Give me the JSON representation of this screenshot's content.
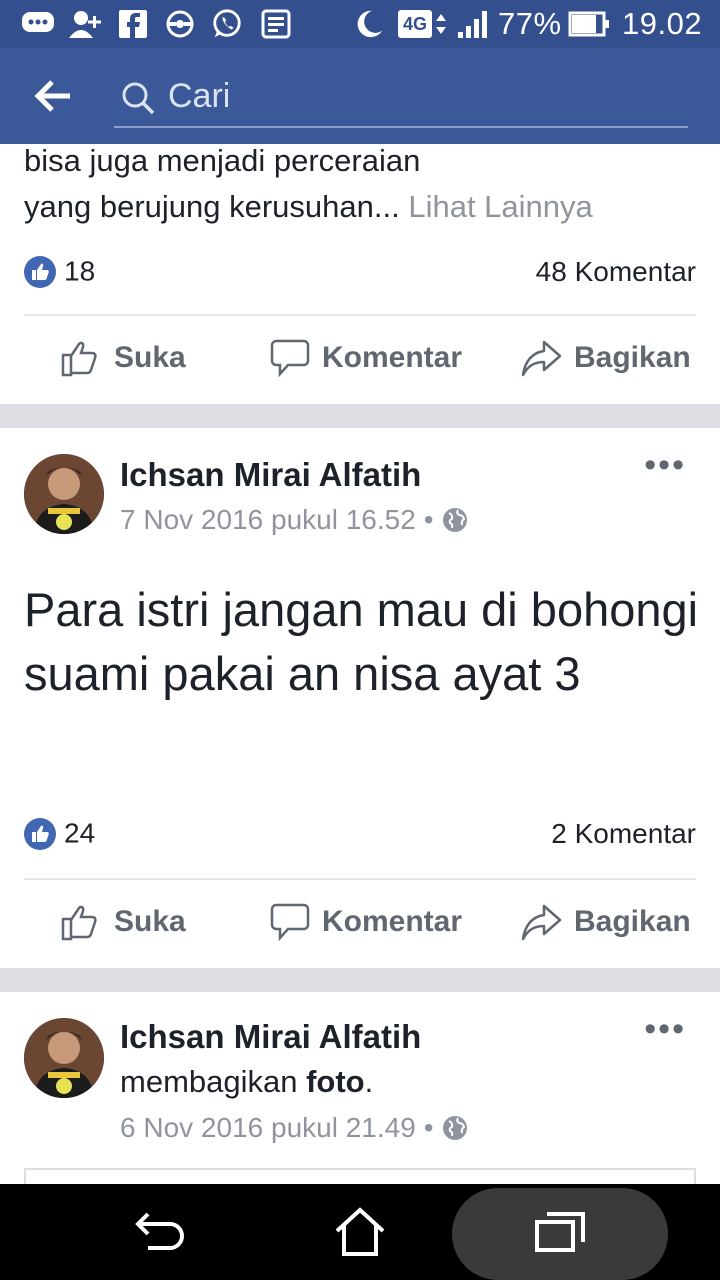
{
  "status_bar": {
    "network": "4G",
    "battery": "77%",
    "time": "19.02",
    "icons": [
      "chat-icon",
      "add-friend-icon",
      "facebook-icon",
      "sync-icon",
      "whatsapp-icon",
      "news-icon",
      "moon-icon",
      "signal-icon",
      "battery-icon"
    ]
  },
  "app_bar": {
    "search_placeholder": "Cari"
  },
  "prev_post": {
    "text_line1": "bisa juga menjadi perceraian",
    "text_line2": "yang berujung kerusuhan...",
    "see_more": "Lihat Lainnya",
    "likes": "18",
    "comments": "48 Komentar",
    "actions": {
      "like": "Suka",
      "comment": "Komentar",
      "share": "Bagikan"
    }
  },
  "post1": {
    "author": "Ichsan Mirai Alfatih",
    "timestamp": "7 Nov 2016 pukul 16.52",
    "text": "Para istri  jangan mau di bohongi suami pakai an nisa ayat 3",
    "likes": "24",
    "comments": "2 Komentar",
    "actions": {
      "like": "Suka",
      "comment": "Komentar",
      "share": "Bagikan"
    }
  },
  "post2": {
    "author": "Ichsan Mirai Alfatih",
    "shared_prefix": "membagikan ",
    "shared_object": "foto",
    "shared_suffix": ".",
    "timestamp": "6 Nov 2016 pukul 21.49"
  },
  "colors": {
    "brand": "#3b5998",
    "status_bar": "#334f8d",
    "like_blue": "#4267b2"
  }
}
